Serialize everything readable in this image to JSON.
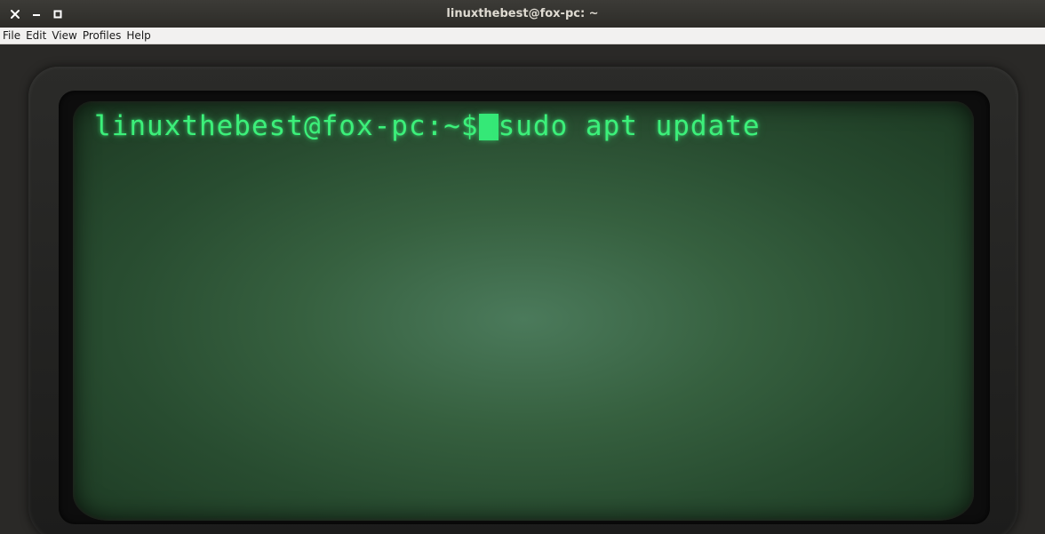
{
  "window": {
    "title": "linuxthebest@fox-pc: ~",
    "controls": [
      "close-icon",
      "minimize-icon",
      "maximize-icon"
    ]
  },
  "menubar": {
    "items": [
      {
        "label": "File"
      },
      {
        "label": "Edit"
      },
      {
        "label": "View"
      },
      {
        "label": "Profiles"
      },
      {
        "label": "Help"
      }
    ]
  },
  "terminal": {
    "prompt": "linuxthebest@fox-pc:~$",
    "command": "sudo apt update",
    "text_color": "#3cf07a",
    "screen_color": "#36603f"
  }
}
